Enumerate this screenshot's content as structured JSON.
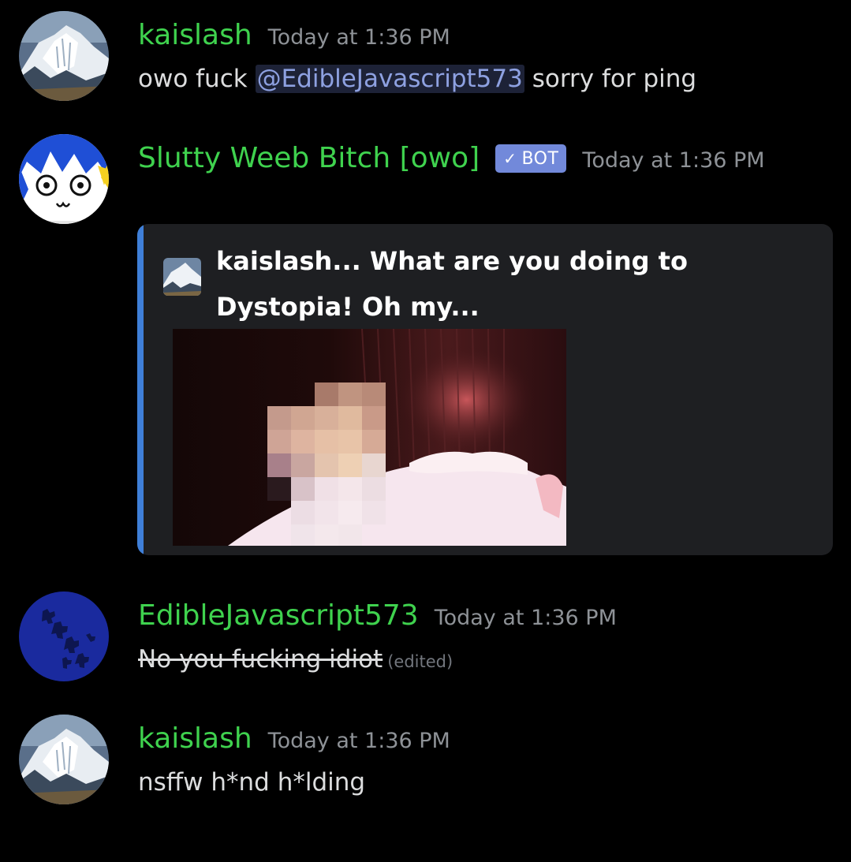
{
  "messages": [
    {
      "username": "kaislash",
      "timestamp": "Today at 1:36 PM",
      "text_before": "owo fuck ",
      "mention": "@EdibleJavascript573",
      "text_after": " sorry for ping"
    },
    {
      "username": "Slutty Weeb Bitch [owo]",
      "bot_tag": "BOT",
      "timestamp": "Today at 1:36 PM",
      "embed": {
        "title": "kaislash... What are you doing to Dystopia! Oh my...",
        "accent_color": "#3f7fd8"
      }
    },
    {
      "username": "EdibleJavascript573",
      "timestamp": "Today at 1:36 PM",
      "text": "No you fucking idiot",
      "edited": "(edited)"
    },
    {
      "username": "kaislash",
      "timestamp": "Today at 1:36 PM",
      "text": "nsffw h*nd h*lding"
    }
  ],
  "icons": {
    "check": "✓"
  },
  "colors": {
    "background": "#000000",
    "username": "#3fd24e",
    "timestamp": "#8e9297",
    "mention_bg": "#3c4a7a",
    "bot_tag": "#7289da",
    "embed_bg": "#1e1f22"
  }
}
